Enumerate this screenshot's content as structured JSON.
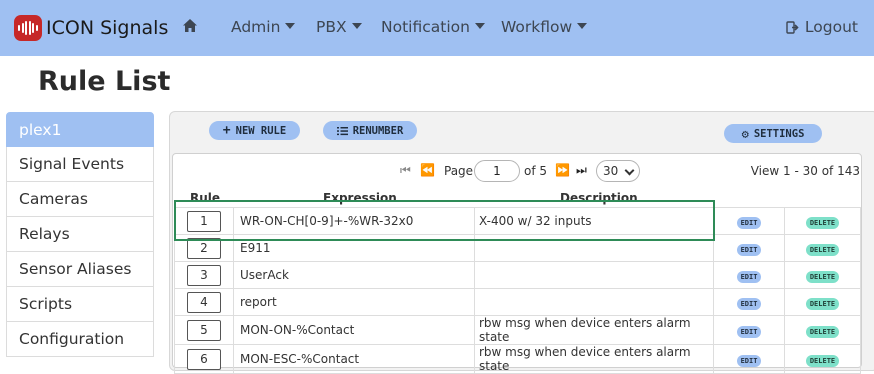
{
  "navbar": {
    "brand": "ICON Signals",
    "menu": [
      {
        "label": "Admin"
      },
      {
        "label": "PBX"
      },
      {
        "label": "Notification"
      },
      {
        "label": "Workflow"
      }
    ],
    "logout": "Logout"
  },
  "page_title": "Rule List",
  "sidebar": {
    "items": [
      {
        "label": "plex1"
      },
      {
        "label": "Signal Events"
      },
      {
        "label": "Cameras"
      },
      {
        "label": "Relays"
      },
      {
        "label": "Sensor Aliases"
      },
      {
        "label": "Scripts"
      },
      {
        "label": "Configuration"
      }
    ]
  },
  "toolbar": {
    "new_rule": "NEW RULE",
    "renumber": "RENUMBER",
    "settings": "SETTINGS"
  },
  "pager": {
    "page_label": "Page",
    "page_value": "1",
    "of_label": "of 5",
    "rows_per_page": "30",
    "view_label": "View 1 - 30 of 143"
  },
  "table": {
    "headers": {
      "rule": "Rule",
      "expression": "Expression",
      "description": "Description"
    },
    "edit_label": "EDIT",
    "delete_label": "DELETE",
    "rows": [
      {
        "rule": "1",
        "expression": "WR-ON-CH[0-9]+-%WR-32x0",
        "description": "X-400 w/ 32 inputs"
      },
      {
        "rule": "2",
        "expression": "E911",
        "description": ""
      },
      {
        "rule": "3",
        "expression": "UserAck",
        "description": ""
      },
      {
        "rule": "4",
        "expression": "report",
        "description": ""
      },
      {
        "rule": "5",
        "expression": "MON-ON-%Contact",
        "description": "rbw msg when device enters alarm state"
      },
      {
        "rule": "6",
        "expression": "MON-ESC-%Contact",
        "description": "rbw msg when device enters alarm state"
      }
    ]
  },
  "colors": {
    "navbar": "#9fc0f2",
    "accent": "#9fc0f2",
    "delete_tag": "#7ee0c9",
    "highlight": "#2e8b57",
    "brand_logo": "#c62828"
  }
}
